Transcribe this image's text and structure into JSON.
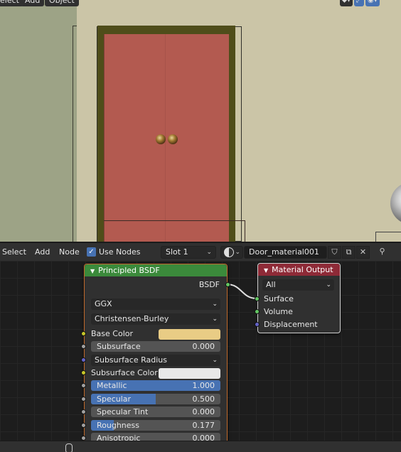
{
  "viewport_menu": {
    "select": "elect",
    "add": "Add",
    "object": "Object"
  },
  "node_header": {
    "select": "Select",
    "add": "Add",
    "node": "Node",
    "use_nodes": "Use Nodes",
    "use_nodes_checked": true,
    "slot": "Slot 1",
    "material_name": "Door_material001"
  },
  "principled_node": {
    "title": "Principled BSDF",
    "header_color": "#3b8a3b",
    "output_label": "BSDF",
    "distribution": "GGX",
    "subsurface_method": "Christensen-Burley",
    "base_color_label": "Base Color",
    "base_color": "#e9cc85",
    "subsurface": {
      "label": "Subsurface",
      "value": "0.000",
      "fraction": 0
    },
    "subsurface_radius": "Subsurface Radius",
    "subsurface_color_label": "Subsurface Color",
    "subsurface_color": "#e8e8e8",
    "metallic": {
      "label": "Metallic",
      "value": "1.000",
      "fraction": 1.0
    },
    "specular": {
      "label": "Specular",
      "value": "0.500",
      "fraction": 0.5
    },
    "specular_tint": {
      "label": "Specular Tint",
      "value": "0.000",
      "fraction": 0
    },
    "roughness": {
      "label": "Roughness",
      "value": "0.177",
      "fraction": 0.177
    },
    "anisotropic": {
      "label": "Anisotropic",
      "value": "0.000",
      "fraction": 0
    }
  },
  "output_node": {
    "title": "Material Output",
    "header_color": "#8e2a37",
    "target": "All",
    "surface": "Surface",
    "volume": "Volume",
    "displacement": "Displacement"
  }
}
